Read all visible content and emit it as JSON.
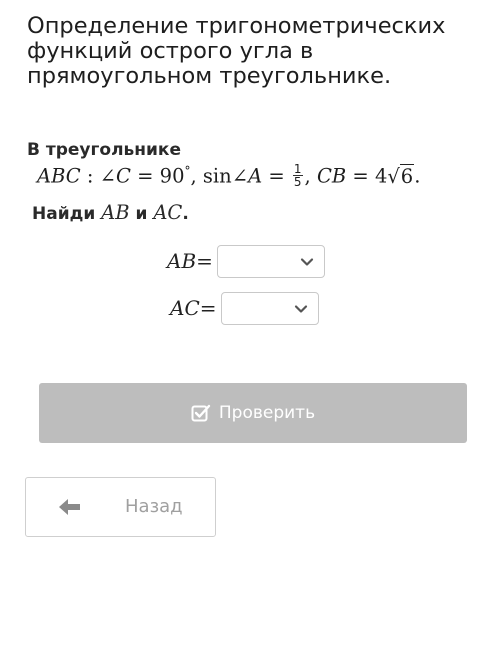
{
  "title": "Определение тригонометрических функций острого угла в прямоугольном треугольнике.",
  "problem": {
    "intro": "В треугольнике",
    "triangle": "ABC",
    "colon": " : ",
    "angle_symbol": "∠",
    "angle_var": "C",
    "eq1": " = 90",
    "degree": "°",
    "sep1": ", ",
    "sin": "sin",
    "angle_var2": "A",
    "eq2": " = ",
    "frac_num": "1",
    "frac_den": "5",
    "sep2": ", ",
    "side": "CB",
    "eq3": " = 4",
    "sqrt_symbol": "√",
    "sqrt_arg": "6",
    "period": "."
  },
  "find": {
    "prefix": "Найди ",
    "first": "AB",
    "conj": " и ",
    "second": "AC",
    "period": "."
  },
  "answers": [
    {
      "label": "AB",
      "eq": " =",
      "value": ""
    },
    {
      "label": "AC",
      "eq": " =",
      "value": ""
    }
  ],
  "check_button": {
    "label": "Проверить",
    "icon": "checkbox-icon"
  },
  "back_button": {
    "label": "Назад",
    "icon": "arrow-left-icon"
  },
  "colors": {
    "check_button_bg": "#bdbdbd",
    "back_button_text": "#a0a0a0",
    "border": "#c9c9c9"
  }
}
